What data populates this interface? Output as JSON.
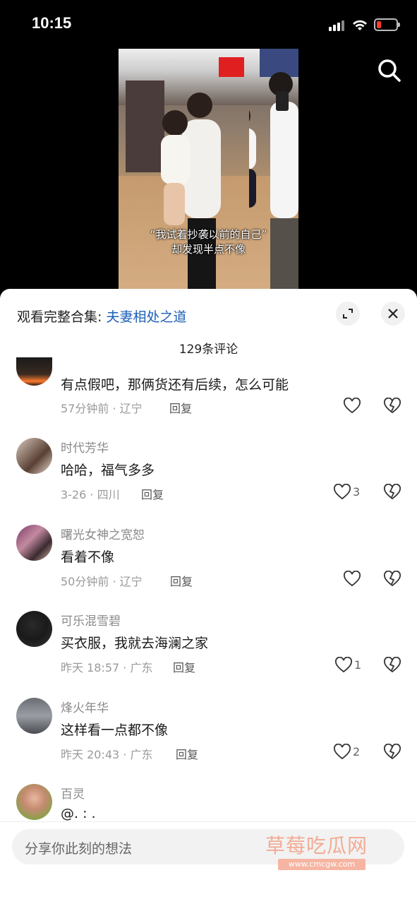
{
  "status": {
    "time": "10:15"
  },
  "video": {
    "caption_line1": "“我试着抄袭以前的自己”",
    "caption_line2": "却发现半点不像"
  },
  "sheet": {
    "collection_prefix": "观看完整合集: ",
    "collection_link": "夫妻相处之道",
    "comment_count": "129条评论"
  },
  "comments": [
    {
      "username": "",
      "text": "有点假吧，那俩货还有后续，怎么可能",
      "meta": "57分钟前 · 辽宁",
      "reply": "回复",
      "likes": ""
    },
    {
      "username": "时代芳华",
      "text": "哈哈，福气多多",
      "meta": "3-26 · 四川",
      "reply": "回复",
      "likes": "3"
    },
    {
      "username": "曙光女神之宽恕",
      "text": "看着不像",
      "meta": "50分钟前 · 辽宁",
      "reply": "回复",
      "likes": ""
    },
    {
      "username": "可乐混雪碧",
      "text": "买衣服，我就去海澜之家",
      "meta": "昨天 18:57 · 广东",
      "reply": "回复",
      "likes": "1"
    },
    {
      "username": "烽火年华",
      "text": "这样看一点都不像",
      "meta": "昨天 20:43 · 广东",
      "reply": "回复",
      "likes": "2"
    },
    {
      "username": "百灵",
      "text": "@. : .",
      "meta": "",
      "reply": "",
      "likes": ""
    }
  ],
  "input": {
    "placeholder": "分享你此刻的想法"
  },
  "watermark": {
    "text": "草莓吃瓜网",
    "url": "www.cmcgw.com"
  },
  "colors": {
    "link": "#1c5fb8",
    "battery_low": "#ff3b30"
  }
}
